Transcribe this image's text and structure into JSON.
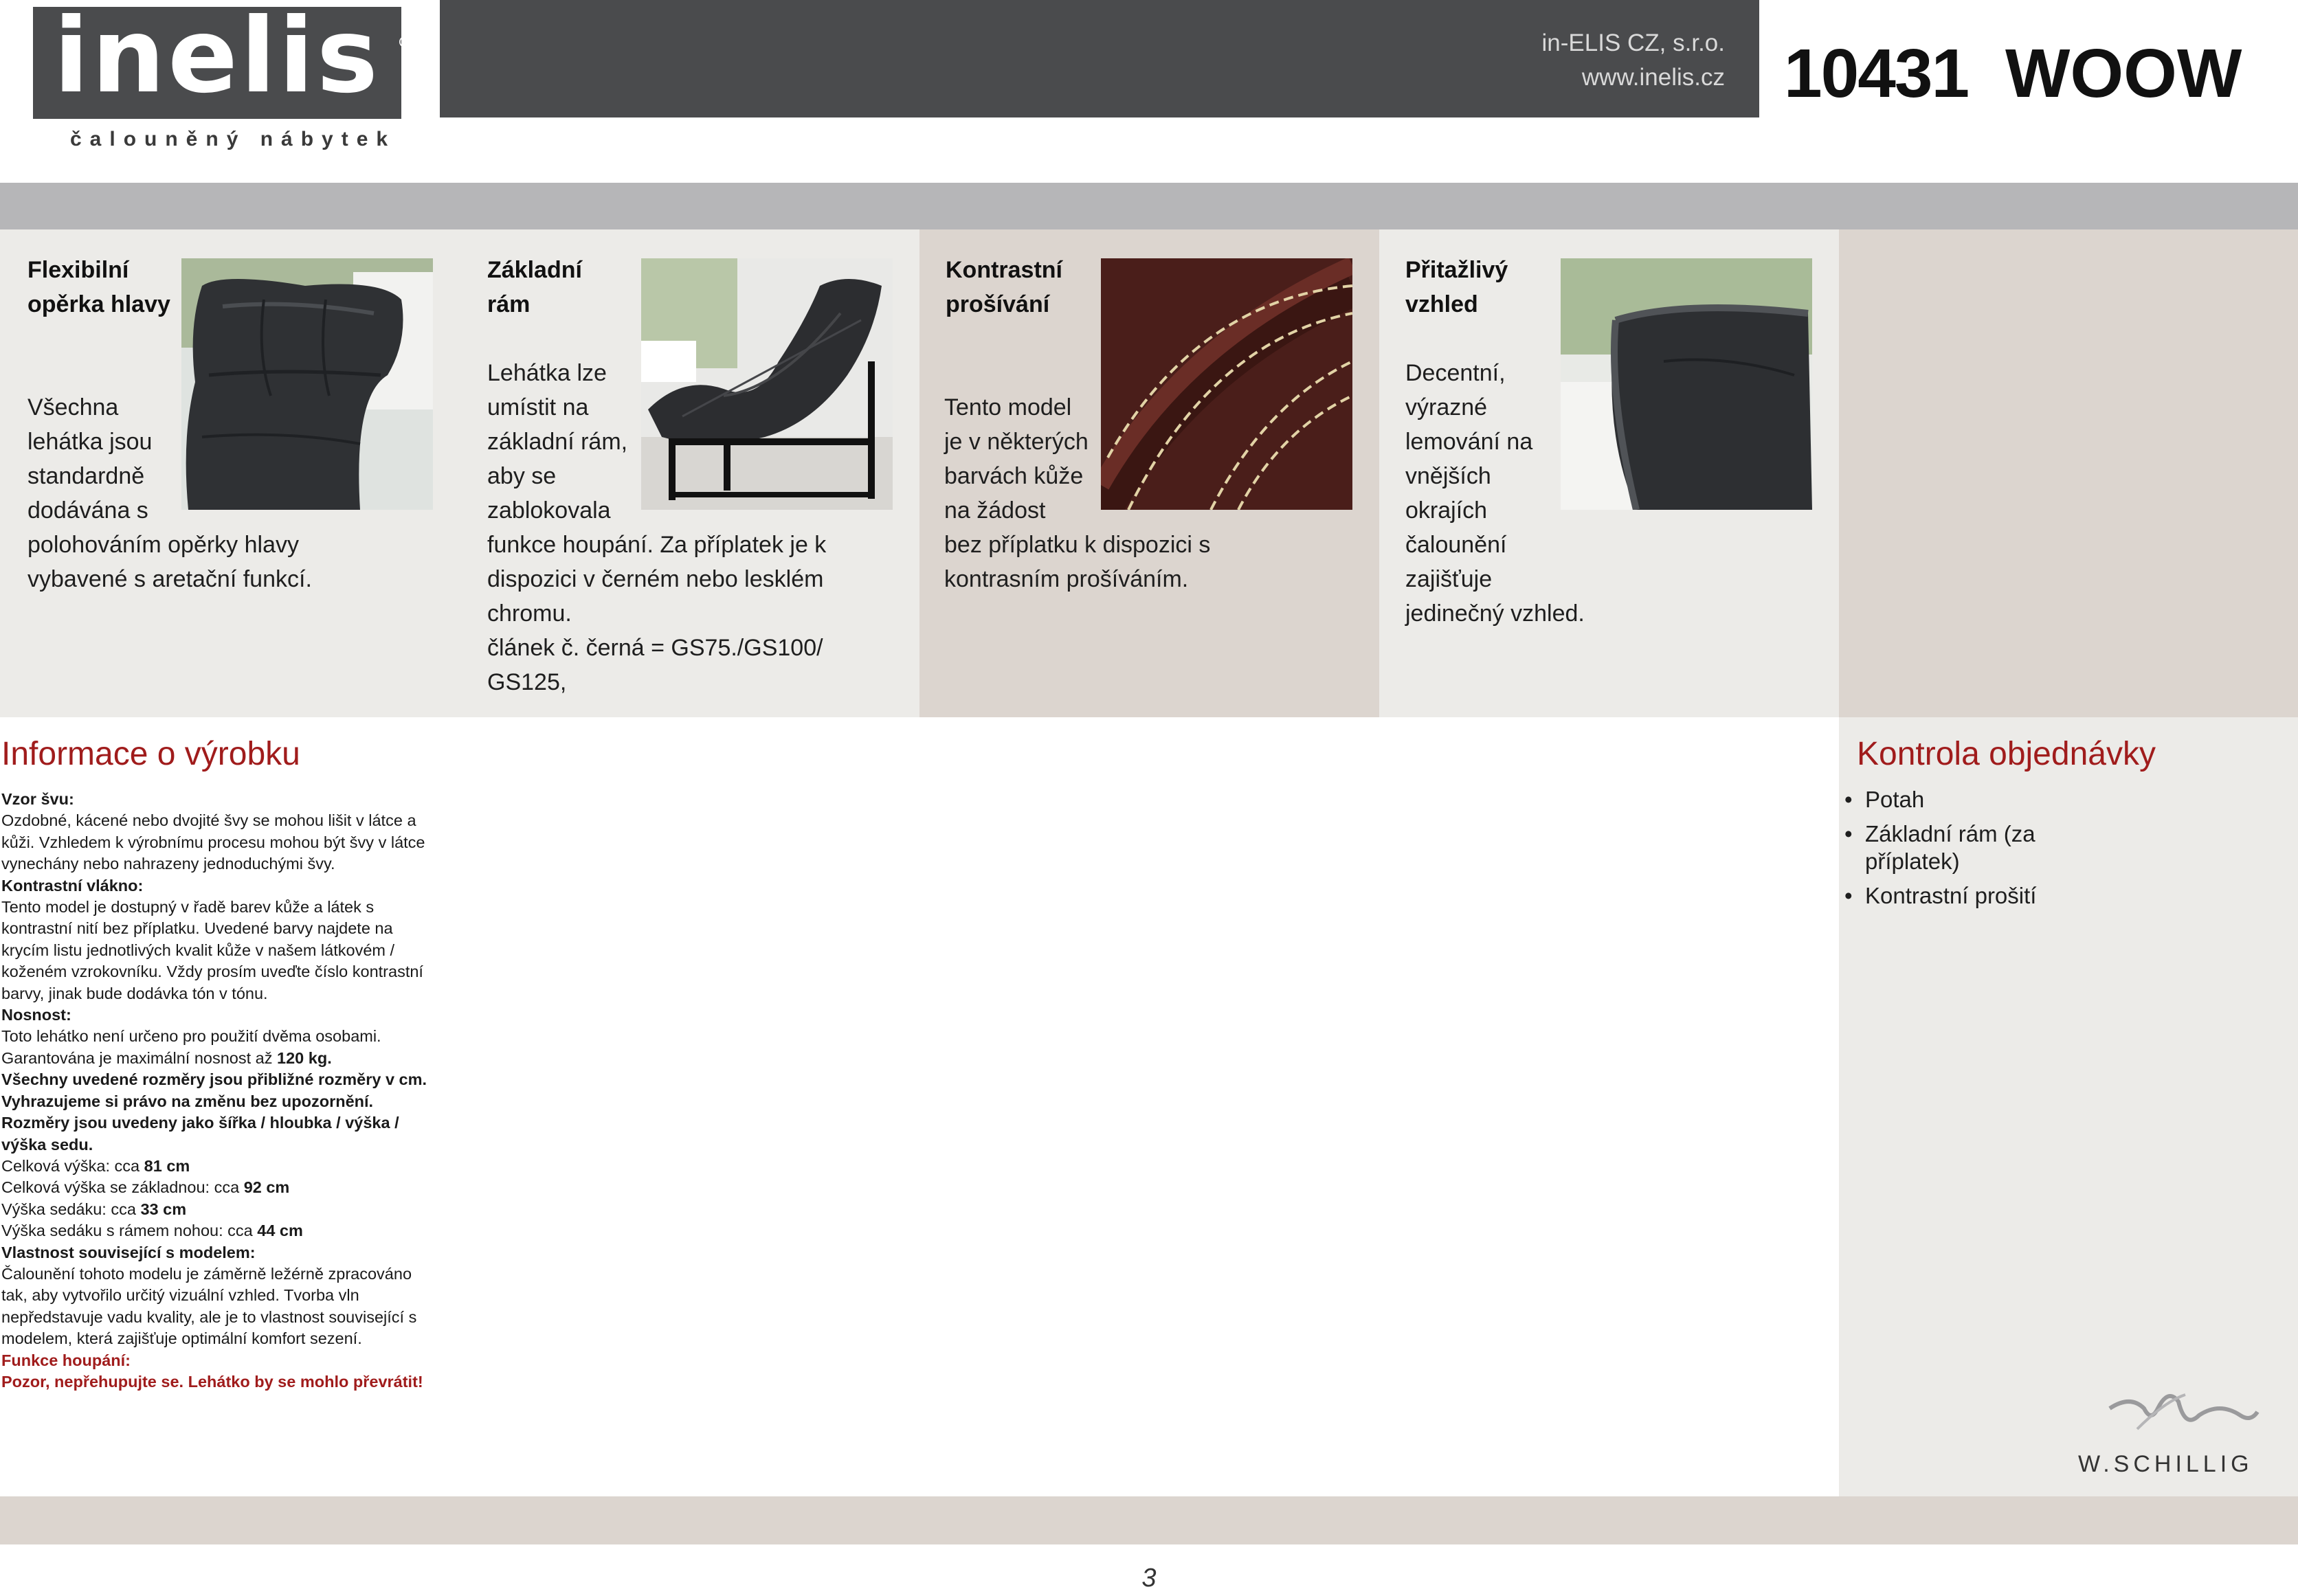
{
  "header": {
    "logo_text": "inelis",
    "logo_reg": "®",
    "tagline": "čalouněný nábytek",
    "company_name": "in-ELIS CZ, s.r.o.",
    "company_web": "www.inelis.cz",
    "model_code": "10431",
    "model_name": "WOOW"
  },
  "features": [
    {
      "title_1": "Flexibilní",
      "title_2": "opěrka hlavy",
      "lines": [
        "Všechna",
        "lehátka jsou",
        "standardně",
        "dodávána s",
        "polohováním opěrky hlavy",
        "vybavené s aretační funkcí."
      ],
      "image": "headrest-photo"
    },
    {
      "title_1": "Základní",
      "title_2": "rám",
      "lines": [
        "Lehátka lze",
        "umístit na",
        "základní rám,",
        "aby se",
        "zablokovala",
        "funkce houpání. Za příplatek je k",
        "dispozici v černém nebo lesklém",
        "chromu.",
        "článek č. černá = GS75./GS100/",
        "GS125,"
      ],
      "image": "base-frame-photo"
    },
    {
      "title_1": "Kontrastní",
      "title_2": "prošívání",
      "lines": [
        "Tento model",
        "je v některých",
        "barvách kůže",
        "na žádost",
        "bez příplatku k dispozici s",
        "kontrasním prošíváním."
      ],
      "image": "stitching-photo"
    },
    {
      "title_1": "Přitažlivý",
      "title_2": "vzhled",
      "lines": [
        "Decentní,",
        "výrazné",
        "lemování na",
        "vnějších",
        "okrajích",
        "čalounění",
        "zajišťuje",
        "jedinečný vzhled."
      ],
      "image": "piping-photo"
    }
  ],
  "info": {
    "title": "Informace o výrobku",
    "seam_heading": "Vzor švu:",
    "seam_text": "Ozdobné, kácené nebo dvojité švy se mohou lišit v látce a kůži. Vzhledem k výrobnímu procesu mohou být švy v látce vynechány nebo nahrazeny jednoduchými švy.",
    "contrast_heading": "Kontrastní vlákno:",
    "contrast_text": "Tento model je dostupný v řadě barev kůže a látek s kontrastní nití bez příplatku. Uvedené barvy najdete na krycím listu jednotlivých kvalit kůže v našem látkovém / koženém vzrokovníku. Vždy prosím uveďte číslo kontrastní barvy, jinak bude dodávka tón v tónu.",
    "load_heading": "Nosnost:",
    "load_text_1": "Toto lehátko není určeno pro použití dvěma osobami.",
    "load_text_2": "Garantována je maximální nosnost až",
    "load_value": "120 kg.",
    "dims_note": "Všechny uvedené rozměry jsou přibližné rozměry v cm. Vyhrazujeme si právo na změnu bez upozornění. Rozměry jsou uvedeny jako šířka / hloubka / výška / výška sedu.",
    "dims": [
      {
        "label": "Celková výška: cca",
        "value": "81 cm"
      },
      {
        "label": "Celková výška se základnou: cca",
        "value": "92 cm"
      },
      {
        "label": "Výška sedáku: cca",
        "value": "33 cm"
      },
      {
        "label": "Výška sedáku s rámem nohou: cca",
        "value": "44 cm"
      }
    ],
    "property_heading": "Vlastnost související s modelem:",
    "property_text": "Čalounění tohoto modelu je záměrně ležérně zpracováno tak, aby vytvořilo určitý vizuální vzhled. Tvorba vln nepředstavuje vadu kvality, ale je to vlastnost související s modelem, která zajišťuje optimální komfort sezení.",
    "rocking_heading": "Funkce houpání:",
    "rocking_text": "Pozor, nepřehupujte se. Lehátko by se mohlo převrátit!"
  },
  "order": {
    "title": "Kontrola objednávky",
    "items": [
      "Potah",
      "Základní rám (za příplatek)",
      "Kontrastní prošití"
    ]
  },
  "brand": {
    "schillig": "W.SCHILLIG"
  },
  "page": {
    "number": "3"
  }
}
